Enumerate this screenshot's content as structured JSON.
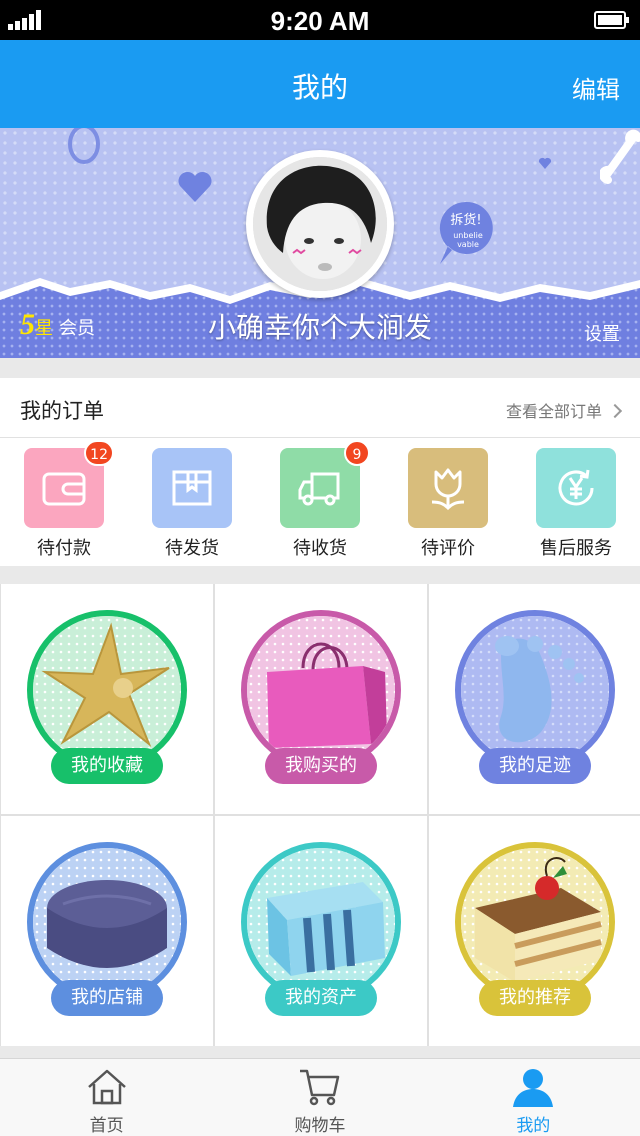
{
  "status_bar": {
    "time": "9:20 AM"
  },
  "nav": {
    "title": "我的",
    "edit_label": "编辑"
  },
  "profile": {
    "username": "小确幸你个大涧发",
    "member_level": "5",
    "member_star": "星",
    "member_label": "会员",
    "settings_label": "设置",
    "sticker_text": "拆货!",
    "sticker_sub1": "unbelie",
    "sticker_sub2": "vable"
  },
  "orders": {
    "title": "我的订单",
    "view_all": "查看全部订单",
    "items": [
      {
        "label": "待付款",
        "icon": "wallet-icon",
        "color": "#fba6bf",
        "badge": "12"
      },
      {
        "label": "待发货",
        "icon": "box-icon",
        "color": "#a8c4f7",
        "badge": ""
      },
      {
        "label": "待收货",
        "icon": "truck-icon",
        "color": "#8fdca7",
        "badge": "9"
      },
      {
        "label": "待评价",
        "icon": "tulip-icon",
        "color": "#d8bd7c",
        "badge": ""
      },
      {
        "label": "售后服务",
        "icon": "yen-refresh-icon",
        "color": "#8fe1dc",
        "badge": ""
      }
    ]
  },
  "grid": [
    {
      "label": "我的收藏",
      "icon": "starfish-icon",
      "color": "#17c06a"
    },
    {
      "label": "我购买的",
      "icon": "shopping-bag-icon",
      "color": "#c85aa9"
    },
    {
      "label": "我的足迹",
      "icon": "footprint-icon",
      "color": "#6f82e0"
    },
    {
      "label": "我的店铺",
      "icon": "ottoman-icon",
      "color": "#5d8fdf"
    },
    {
      "label": "我的资产",
      "icon": "gift-box-icon",
      "color": "#3cc9c6"
    },
    {
      "label": "我的推荐",
      "icon": "cake-icon",
      "color": "#d9c33a"
    }
  ],
  "tabs": [
    {
      "label": "首页",
      "icon": "home-icon",
      "active": false
    },
    {
      "label": "购物车",
      "icon": "cart-icon",
      "active": false
    },
    {
      "label": "我的",
      "icon": "user-icon",
      "active": true
    }
  ],
  "colors": {
    "primary": "#1a9bf2",
    "badge": "#f24620",
    "banner": "#b8c2f2"
  }
}
